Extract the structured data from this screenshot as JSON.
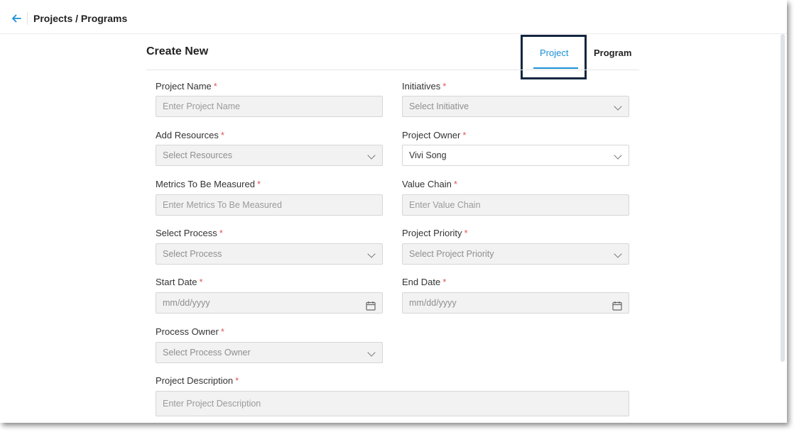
{
  "header": {
    "breadcrumb": "Projects / Programs"
  },
  "form": {
    "title": "Create New",
    "tabs": [
      {
        "label": "Project",
        "active": true
      },
      {
        "label": "Program",
        "active": false
      }
    ],
    "required_marker": "*",
    "fields": {
      "project_name": {
        "label": "Project Name",
        "placeholder": "Enter Project Name"
      },
      "initiatives": {
        "label": "Initiatives",
        "value": "Select Initiative"
      },
      "add_resources": {
        "label": "Add Resources",
        "value": "Select Resources"
      },
      "project_owner": {
        "label": "Project Owner",
        "value": "Vivi Song"
      },
      "metrics": {
        "label": "Metrics To Be Measured",
        "placeholder": "Enter Metrics To Be Measured"
      },
      "value_chain": {
        "label": "Value Chain",
        "placeholder": "Enter Value Chain"
      },
      "select_process": {
        "label": "Select Process",
        "value": "Select Process"
      },
      "project_priority": {
        "label": "Project Priority",
        "value": "Select Project Priority"
      },
      "start_date": {
        "label": "Start Date",
        "placeholder": "mm/dd/yyyy"
      },
      "end_date": {
        "label": "End Date",
        "placeholder": "mm/dd/yyyy"
      },
      "process_owner": {
        "label": "Process Owner",
        "value": "Select Process Owner"
      },
      "project_description": {
        "label": "Project Description",
        "placeholder": "Enter Project Description"
      }
    }
  },
  "colors": {
    "accent": "#1a8fd6",
    "required": "#e05656",
    "highlight_border": "#142640"
  },
  "icons": {
    "back": "arrow-left-icon",
    "dropdown": "chevron-down-icon",
    "date": "calendar-icon"
  }
}
